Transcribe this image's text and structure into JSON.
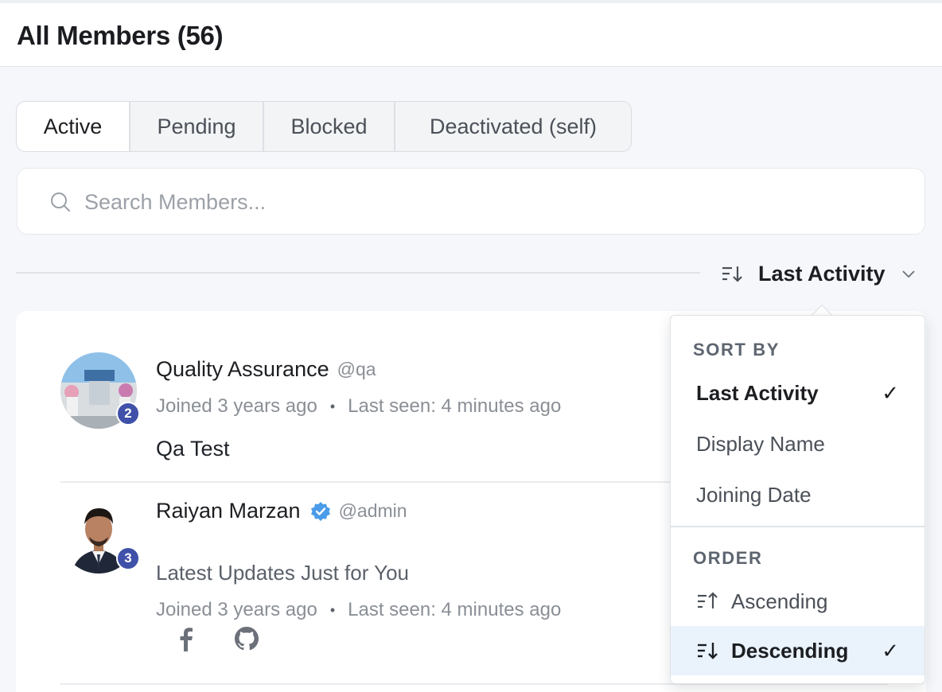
{
  "page": {
    "title": "All Members (56)"
  },
  "tabs": [
    {
      "label": "Active",
      "active": true
    },
    {
      "label": "Pending",
      "active": false
    },
    {
      "label": "Blocked",
      "active": false
    },
    {
      "label": "Deactivated (self)",
      "active": false
    }
  ],
  "search": {
    "placeholder": "Search Members...",
    "value": "",
    "icon": "search-icon"
  },
  "sort": {
    "current_label": "Last Activity",
    "icon": "sort-descending-icon",
    "chevron": "chevron-down-icon"
  },
  "members": [
    {
      "name": "Quality Assurance",
      "handle": "@qa",
      "badge": "2",
      "joined": "Joined 3 years ago",
      "dot": "•",
      "last_seen": "Last seen: 4 minutes ago",
      "bio": "Qa Test",
      "verified": false
    },
    {
      "name": "Raiyan Marzan",
      "handle": "@admin",
      "badge": "3",
      "tagline": "Latest Updates Just for You",
      "joined": "Joined 3 years ago",
      "dot": "•",
      "last_seen": "Last seen: 4 minutes ago",
      "verified": true,
      "social": [
        "facebook-icon",
        "github-icon"
      ]
    }
  ],
  "dropdown": {
    "sort_by_title": "SORT BY",
    "sort_options": [
      {
        "label": "Last Activity",
        "selected": true
      },
      {
        "label": "Display Name",
        "selected": false
      },
      {
        "label": "Joining Date",
        "selected": false
      }
    ],
    "order_title": "ORDER",
    "order_options": [
      {
        "label": "Ascending",
        "selected": false,
        "icon": "sort-ascending-icon"
      },
      {
        "label": "Descending",
        "selected": true,
        "icon": "sort-descending-icon"
      }
    ],
    "check_mark": "✓"
  },
  "colors": {
    "badge": "#3f51a8",
    "verified": "#4a9be8",
    "selected_row_bg": "#eaf2fc"
  }
}
